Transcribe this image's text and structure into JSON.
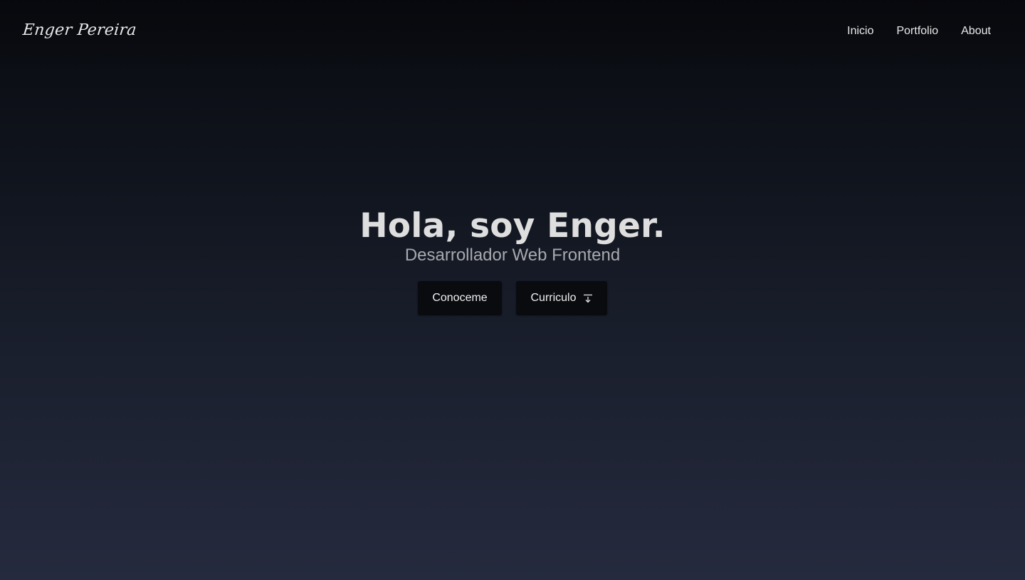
{
  "navbar": {
    "logo": "Enger Pereira",
    "links": [
      {
        "label": "Inicio"
      },
      {
        "label": "Portfolio"
      },
      {
        "label": "About"
      }
    ]
  },
  "hero": {
    "title": "Hola, soy Enger.",
    "subtitle": "Desarrollador Web Frontend",
    "buttons": {
      "about_label": "Conoceme",
      "cv_label": "Curriculo",
      "cv_icon": "download-icon"
    }
  },
  "colors": {
    "background_top": "#090b10",
    "background_bottom": "#252a3e",
    "button_bg": "#0a0b0f",
    "text_primary": "#dedede",
    "text_secondary": "#a7a9ae"
  }
}
